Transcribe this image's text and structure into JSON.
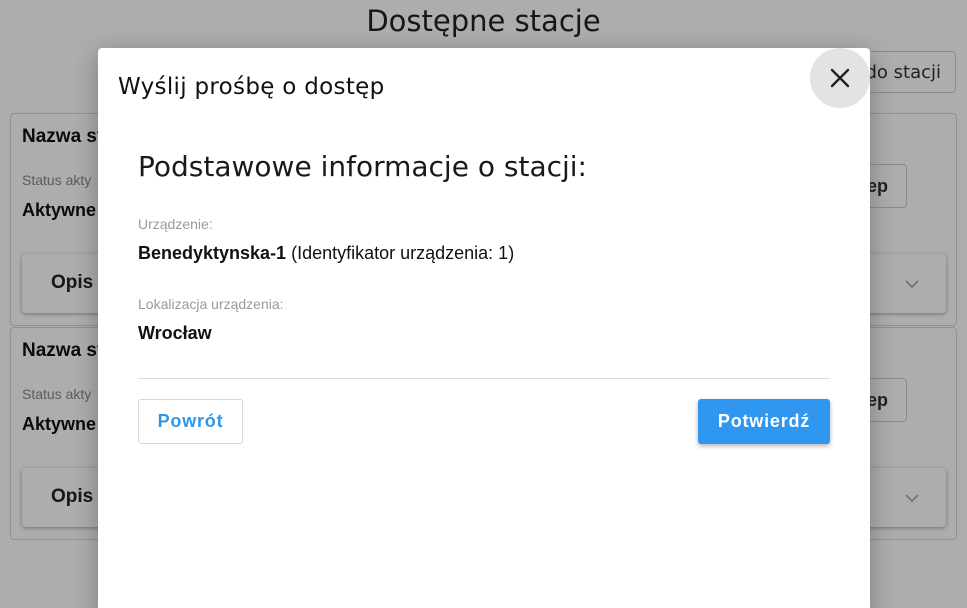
{
  "background": {
    "page_title": "Dostępne stacje",
    "request_button_label": "do stacji",
    "cards": [
      {
        "name": "Nazwa st",
        "status_label": "Status akty",
        "status_value": "Aktywne",
        "button_label": "ep",
        "description_label": "Opis"
      },
      {
        "name": "Nazwa st",
        "status_label": "Status akty",
        "status_value": "Aktywne",
        "button_label": "ep",
        "description_label": "Opis"
      }
    ]
  },
  "modal": {
    "title": "Wyślij prośbę o dostęp",
    "close_icon": "close-icon",
    "section_heading": "Podstawowe informacje o stacji:",
    "device_label": "Urządzenie:",
    "device_name": "Benedyktynska-1",
    "device_id_text": " (Identyfikator urządzenia: 1)",
    "location_label": "Lokalizacja urządzenia:",
    "location_value": "Wrocław",
    "back_button": "Powrót",
    "confirm_button": "Potwierdź"
  },
  "colors": {
    "accent": "#2f97ef",
    "overlay": "#000000"
  }
}
